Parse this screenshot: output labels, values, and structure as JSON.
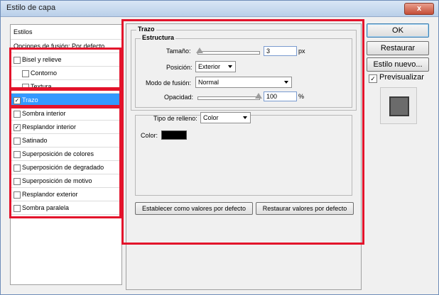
{
  "window": {
    "title": "Estilo de capa",
    "close_label": "x"
  },
  "sidebar": {
    "header": "Estilos",
    "blend_options": "Opciones de fusión: Por defecto",
    "items": [
      {
        "label": "Bisel y relieve",
        "checked": false,
        "indent": false
      },
      {
        "label": "Contorno",
        "checked": false,
        "indent": true
      },
      {
        "label": "Textura",
        "checked": false,
        "indent": true
      },
      {
        "label": "Trazo",
        "checked": true,
        "indent": false,
        "selected": true
      },
      {
        "label": "Sombra interior",
        "checked": false,
        "indent": false
      },
      {
        "label": "Resplandor interior",
        "checked": true,
        "indent": false
      },
      {
        "label": "Satinado",
        "checked": false,
        "indent": false
      },
      {
        "label": "Superposición de colores",
        "checked": false,
        "indent": false
      },
      {
        "label": "Superposición de degradado",
        "checked": false,
        "indent": false
      },
      {
        "label": "Superposición de motivo",
        "checked": false,
        "indent": false
      },
      {
        "label": "Resplandor exterior",
        "checked": false,
        "indent": false
      },
      {
        "label": "Sombra paralela",
        "checked": false,
        "indent": false
      }
    ]
  },
  "stroke": {
    "group_title": "Trazo",
    "structure_title": "Estructura",
    "size_label": "Tamaño:",
    "size_value": "3",
    "size_unit": "px",
    "size_slider_fraction": 0.03,
    "position_label": "Posición:",
    "position_value": "Exterior",
    "blend_label": "Modo de fusión:",
    "blend_value": "Normal",
    "opacity_label": "Opacidad:",
    "opacity_value": "100",
    "opacity_unit": "%",
    "opacity_slider_fraction": 1.0,
    "fill_type_label": "Tipo de relleno:",
    "fill_type_value": "Color",
    "color_label": "Color:",
    "color_hex": "#000000",
    "set_default_label": "Establecer como valores por defecto",
    "reset_default_label": "Restaurar valores por defecto"
  },
  "actions": {
    "ok": "OK",
    "reset": "Restaurar",
    "new_style": "Estilo nuevo...",
    "preview_label": "Previsualizar",
    "preview_checked": true
  },
  "colors": {
    "annotation_red": "#e3132b",
    "selection_blue": "#3399ff"
  }
}
